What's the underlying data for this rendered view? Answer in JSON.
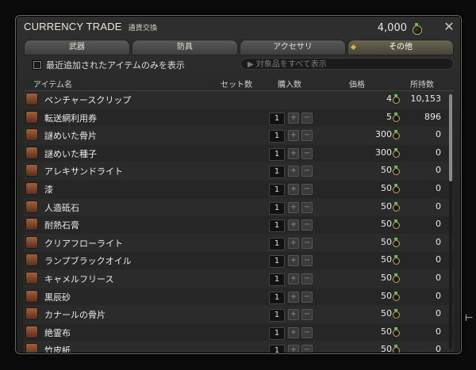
{
  "window": {
    "title": "CURRENCY TRADE",
    "subtitle": "通貨交換",
    "currency_total": "4,000"
  },
  "tabs": [
    {
      "label": "武器",
      "active": false
    },
    {
      "label": "防具",
      "active": false
    },
    {
      "label": "アクセサリ",
      "active": false
    },
    {
      "label": "その他",
      "active": true
    }
  ],
  "filter": {
    "checkbox_label": "最近追加されたアイテムのみを表示",
    "search_placeholder": "▶ 対象品をすべて表示"
  },
  "columns": {
    "item": "アイテム名",
    "set": "セット数",
    "buy": "購入数",
    "price": "価格",
    "owned": "所持数"
  },
  "icons": {
    "currency": "allagan-tomestone-icon",
    "close": "close-icon",
    "plus": "+",
    "minus": "−"
  },
  "items": [
    {
      "name": "ベンチャースクリップ",
      "qty": "",
      "price": "4",
      "owned": "10,153",
      "icon": "venture-icon"
    },
    {
      "name": "転送網利用券",
      "qty": "1",
      "price": "5",
      "owned": "896",
      "icon": "star-ticket-icon"
    },
    {
      "name": "謎めいた骨片",
      "qty": "1",
      "price": "300",
      "owned": "0",
      "icon": "bone-chest-icon"
    },
    {
      "name": "謎めいた種子",
      "qty": "1",
      "price": "300",
      "owned": "0",
      "icon": "seed-chest-icon"
    },
    {
      "name": "アレキサンドライト",
      "qty": "1",
      "price": "50",
      "owned": "0",
      "icon": "gem-icon"
    },
    {
      "name": "漆",
      "qty": "1",
      "price": "50",
      "owned": "0",
      "icon": "lacquer-icon"
    },
    {
      "name": "人造砥石",
      "qty": "1",
      "price": "50",
      "owned": "0",
      "icon": "whetstone-icon"
    },
    {
      "name": "耐熱石膏",
      "qty": "1",
      "price": "50",
      "owned": "0",
      "icon": "gypsum-icon"
    },
    {
      "name": "クリアフローライト",
      "qty": "1",
      "price": "50",
      "owned": "0",
      "icon": "fluorite-icon"
    },
    {
      "name": "ランプブラックオイル",
      "qty": "1",
      "price": "50",
      "owned": "0",
      "icon": "oil-icon"
    },
    {
      "name": "キャメルフリース",
      "qty": "1",
      "price": "50",
      "owned": "0",
      "icon": "fleece-icon"
    },
    {
      "name": "黒辰砂",
      "qty": "1",
      "price": "50",
      "owned": "0",
      "icon": "cinnabar-icon"
    },
    {
      "name": "カナールの骨片",
      "qty": "1",
      "price": "50",
      "owned": "0",
      "icon": "bone-icon"
    },
    {
      "name": "絶霊布",
      "qty": "1",
      "price": "50",
      "owned": "0",
      "icon": "cloth-icon"
    },
    {
      "name": "竹皮紙",
      "qty": "1",
      "price": "50",
      "owned": "0",
      "icon": "paper-icon"
    }
  ]
}
